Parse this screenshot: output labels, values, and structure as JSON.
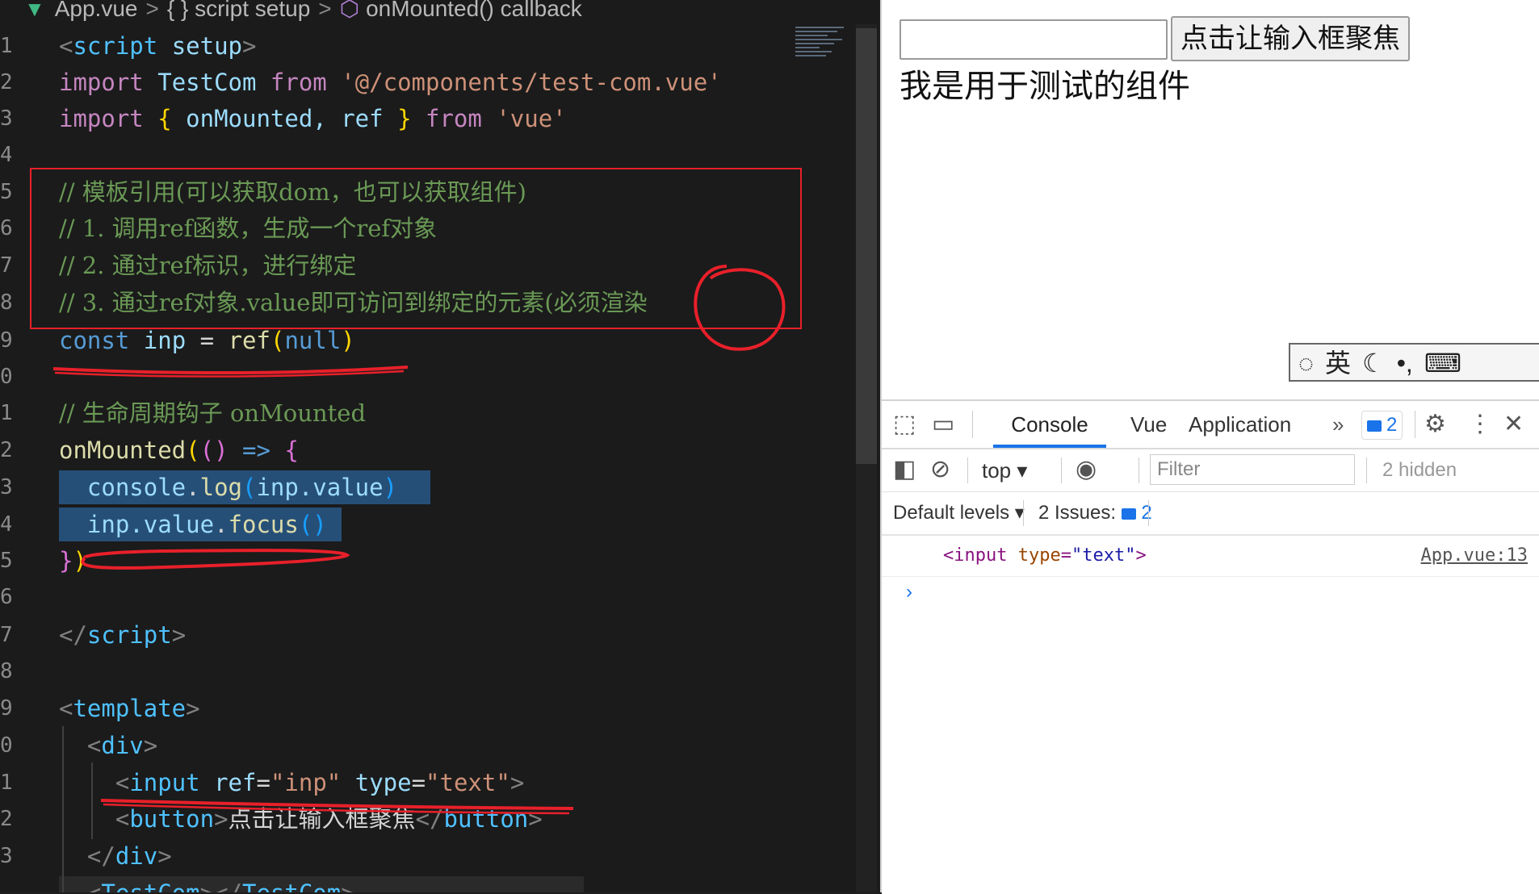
{
  "editor": {
    "breadcrumb": {
      "file": "App.vue",
      "section": "{ } script setup",
      "symbol": "onMounted() callback"
    },
    "line_numbers": [
      "1",
      "2",
      "3",
      "4",
      "5",
      "6",
      "7",
      "8",
      "9",
      "0",
      "1",
      "2",
      "3",
      "4",
      "5",
      "6",
      "7",
      "8",
      "9",
      "0",
      "1",
      "2",
      "3"
    ],
    "code": {
      "script_open_tag": "script",
      "script_open_attr": "setup",
      "import1_kw": "import",
      "import1_name": "TestCom",
      "import1_from": "from",
      "import1_path": "'@/components/test-com.vue'",
      "import2_kw": "import",
      "import2_names": "onMounted, ref",
      "import2_from": "from",
      "import2_path": "'vue'",
      "comment1": "// 模板引用(可以获取dom，也可以获取组件)",
      "comment2": "// 1. 调用ref函数，生成一个ref对象",
      "comment3": "// 2. 通过ref标识，进行绑定",
      "comment4": "// 3. 通过ref对象.value即可访问到绑定的元素(必须渲染",
      "const_kw": "const",
      "const_name": "inp",
      "const_fn": "ref",
      "const_arg": "null",
      "comment5": "// 生命周期钩子 onMounted",
      "onmounted_fn": "onMounted",
      "log_obj": "console",
      "log_fn": "log",
      "log_arg": "inp.value",
      "focus_obj": "inp.value",
      "focus_fn": "focus",
      "script_close_tag": "script",
      "template_tag": "template",
      "div_tag": "div",
      "input_tag": "input",
      "input_attr_ref": "ref",
      "input_attr_ref_val": "\"inp\"",
      "input_attr_type": "type",
      "input_attr_type_val": "\"text\"",
      "button_tag": "button",
      "button_text": "点击让输入框聚焦",
      "div_close_tag": "div",
      "testcom_tag": "TestCom"
    }
  },
  "browser": {
    "button_label": "点击让输入框聚焦",
    "component_text": "我是用于测试的组件",
    "ime": {
      "lang": "英"
    },
    "devtools": {
      "tabs": [
        "Console",
        "Vue",
        "Application"
      ],
      "issues_badge_count": "2",
      "context": "top",
      "filter_placeholder": "Filter",
      "hidden_count": "2 hidden",
      "levels": "Default levels",
      "issues_label": "2 Issues:",
      "issues_count": "2",
      "console_output": {
        "tag": "input",
        "attr": "type",
        "value": "\"text\"",
        "source": "App.vue:13"
      }
    }
  },
  "colors": {
    "annotation_red": "#e8202a",
    "selection": "#264f78",
    "devtools_accent": "#1a73e8"
  }
}
